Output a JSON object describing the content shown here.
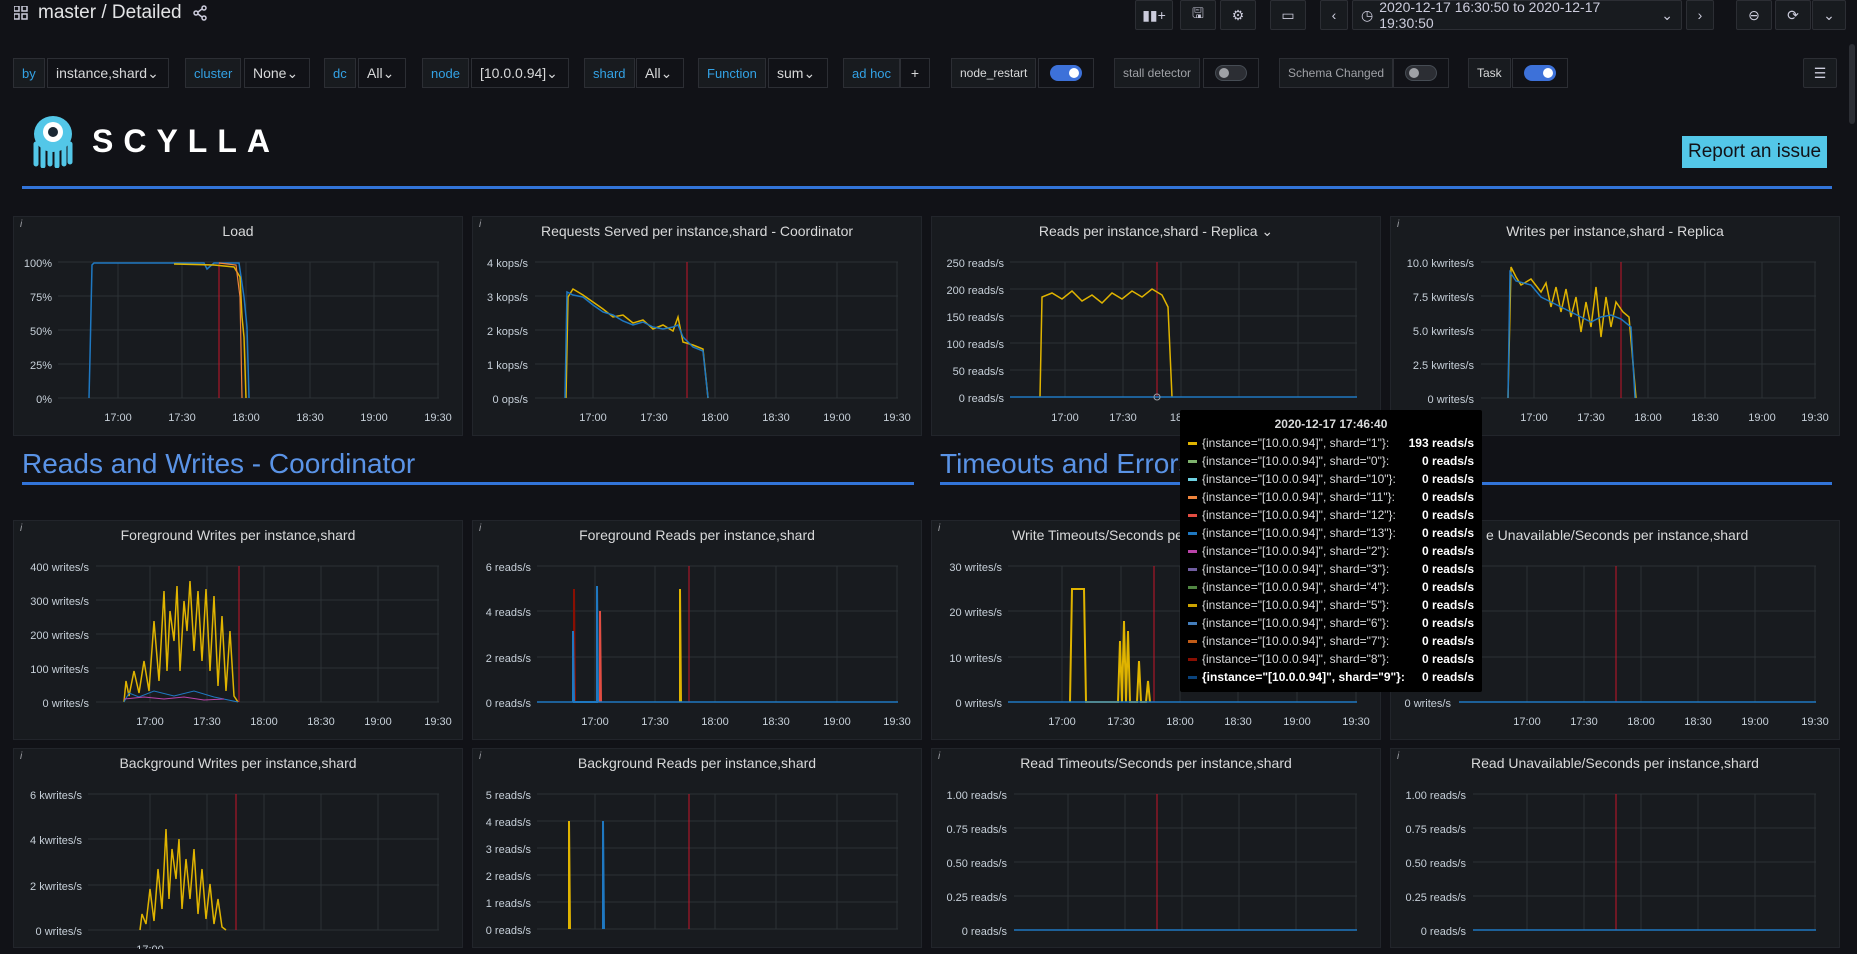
{
  "header": {
    "title": "master / Detailed",
    "time_range": "2020-12-17 16:30:50 to 2020-12-17 19:30:50"
  },
  "vars": {
    "by_label": "by",
    "by_value": "instance,shard",
    "cluster_label": "cluster",
    "cluster_value": "None",
    "dc_label": "dc",
    "dc_value": "All",
    "node_label": "node",
    "node_value": "[10.0.0.94]",
    "shard_label": "shard",
    "shard_value": "All",
    "function_label": "Function",
    "function_value": "sum",
    "adhoc_label": "ad hoc",
    "adhoc_add": "+",
    "node_restart_label": "node_restart",
    "stall_label": "stall detector",
    "schema_label": "Schema Changed",
    "task_label": "Task"
  },
  "toggles": {
    "node_restart": true,
    "stall": false,
    "schema": false,
    "task": true
  },
  "logo": {
    "text": "SCYLLA"
  },
  "report_button": "Report an issue",
  "sections": {
    "rw_coordinator": "Reads and Writes - Coordinator",
    "timeouts": "Timeouts and Errors"
  },
  "colors": {
    "yellow": "#e0b400",
    "blue": "#1f78c1",
    "red": "#c4162a",
    "accent": "#3274d9",
    "toggle_on": "#3d71d9"
  },
  "x_ticks": [
    "17:00",
    "17:30",
    "18:00",
    "18:30",
    "19:00",
    "19:30"
  ],
  "panels": {
    "load": {
      "title": "Load",
      "y_ticks": [
        "100%",
        "75%",
        "50%",
        "25%",
        "0%"
      ]
    },
    "requests": {
      "title": "Requests Served per instance,shard - Coordinator",
      "y_ticks": [
        "4 kops/s",
        "3 kops/s",
        "2 kops/s",
        "1 kops/s",
        "0 ops/s"
      ]
    },
    "reads_replica": {
      "title": "Reads per instance,shard - Replica",
      "y_ticks": [
        "250 reads/s",
        "200 reads/s",
        "150 reads/s",
        "100 reads/s",
        "50 reads/s",
        "0 reads/s"
      ],
      "x_ticks_visible": [
        "17:00",
        "17:30",
        "18"
      ]
    },
    "writes_replica": {
      "title": "Writes per instance,shard - Replica",
      "y_ticks": [
        "10.0 kwrites/s",
        "7.5 kwrites/s",
        "5.0 kwrites/s",
        "2.5 kwrites/s",
        "0 writes/s"
      ]
    },
    "fg_writes": {
      "title": "Foreground Writes per instance,shard",
      "y_ticks": [
        "400 writes/s",
        "300 writes/s",
        "200 writes/s",
        "100 writes/s",
        "0 writes/s"
      ]
    },
    "fg_reads": {
      "title": "Foreground Reads per instance,shard",
      "y_ticks": [
        "6 reads/s",
        "4 reads/s",
        "2 reads/s",
        "0 reads/s"
      ]
    },
    "write_timeouts": {
      "title": "Write Timeouts/Seconds pe",
      "y_ticks": [
        "30 writes/s",
        "20 writes/s",
        "10 writes/s",
        "0 writes/s"
      ]
    },
    "write_unavail": {
      "title": "e Unavailable/Seconds per instance,shard",
      "y_ticks": [
        "0 writes/s"
      ]
    },
    "bg_writes": {
      "title": "Background Writes per instance,shard",
      "y_ticks": [
        "6 kwrites/s",
        "4 kwrites/s",
        "2 kwrites/s",
        "0 writes/s"
      ]
    },
    "bg_reads": {
      "title": "Background Reads per instance,shard",
      "y_ticks": [
        "5 reads/s",
        "4 reads/s",
        "3 reads/s",
        "2 reads/s",
        "1 reads/s",
        "0 reads/s"
      ]
    },
    "read_timeouts": {
      "title": "Read Timeouts/Seconds per instance,shard",
      "y_ticks": [
        "1.00 reads/s",
        "0.75 reads/s",
        "0.50 reads/s",
        "0.25 reads/s",
        "0 reads/s"
      ]
    },
    "read_unavail": {
      "title": "Read Unavailable/Seconds per instance,shard",
      "y_ticks": [
        "1.00 reads/s",
        "0.75 reads/s",
        "0.50 reads/s",
        "0.25 reads/s",
        "0 reads/s"
      ]
    }
  },
  "tooltip": {
    "time": "2020-12-17 17:46:40",
    "rows": [
      {
        "label": "{instance=\"[10.0.0.94]\", shard=\"1\"}:",
        "value": "193 reads/s",
        "color": "#e0b400"
      },
      {
        "label": "{instance=\"[10.0.0.94]\", shard=\"0\"}:",
        "value": "0 reads/s",
        "color": "#7eb26d"
      },
      {
        "label": "{instance=\"[10.0.0.94]\", shard=\"10\"}:",
        "value": "0 reads/s",
        "color": "#6ed0e0"
      },
      {
        "label": "{instance=\"[10.0.0.94]\", shard=\"11\"}:",
        "value": "0 reads/s",
        "color": "#ef843c"
      },
      {
        "label": "{instance=\"[10.0.0.94]\", shard=\"12\"}:",
        "value": "0 reads/s",
        "color": "#e24d42"
      },
      {
        "label": "{instance=\"[10.0.0.94]\", shard=\"13\"}:",
        "value": "0 reads/s",
        "color": "#1f78c1"
      },
      {
        "label": "{instance=\"[10.0.0.94]\", shard=\"2\"}:",
        "value": "0 reads/s",
        "color": "#ba43a9"
      },
      {
        "label": "{instance=\"[10.0.0.94]\", shard=\"3\"}:",
        "value": "0 reads/s",
        "color": "#705da0"
      },
      {
        "label": "{instance=\"[10.0.0.94]\", shard=\"4\"}:",
        "value": "0 reads/s",
        "color": "#508642"
      },
      {
        "label": "{instance=\"[10.0.0.94]\", shard=\"5\"}:",
        "value": "0 reads/s",
        "color": "#cca300"
      },
      {
        "label": "{instance=\"[10.0.0.94]\", shard=\"6\"}:",
        "value": "0 reads/s",
        "color": "#447ebc"
      },
      {
        "label": "{instance=\"[10.0.0.94]\", shard=\"7\"}:",
        "value": "0 reads/s",
        "color": "#c15c17"
      },
      {
        "label": "{instance=\"[10.0.0.94]\", shard=\"8\"}:",
        "value": "0 reads/s",
        "color": "#890f02"
      },
      {
        "label": "{instance=\"[10.0.0.94]\", shard=\"9\"}:",
        "value": "0 reads/s",
        "color": "#0a437c"
      }
    ]
  }
}
